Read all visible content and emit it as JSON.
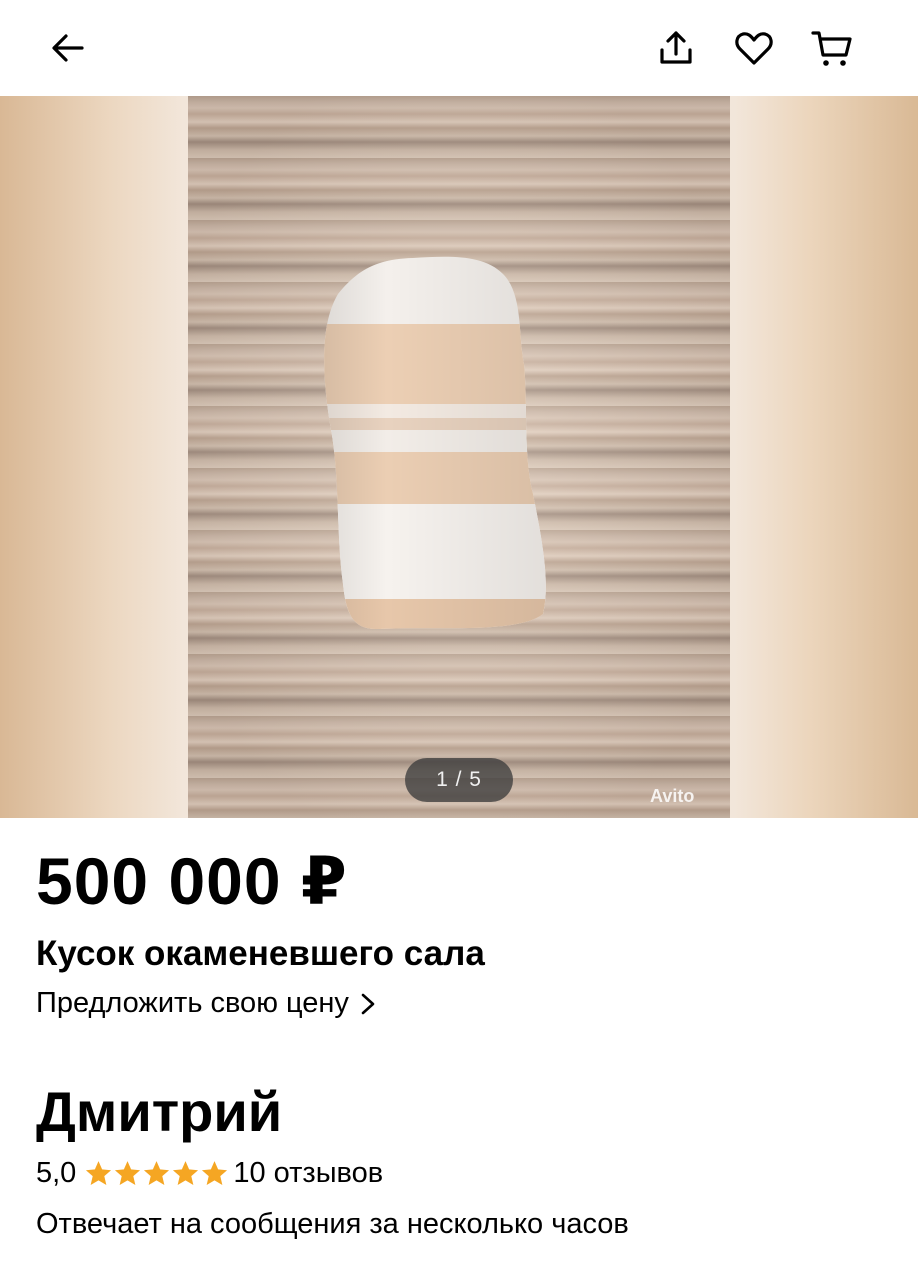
{
  "icons": {
    "back": "arrow-left-icon",
    "share": "share-icon",
    "favorite": "heart-icon",
    "cart": "cart-icon",
    "offer_chevron": "chevron-right-icon",
    "star": "star-icon"
  },
  "colors": {
    "star": "#f5a623",
    "counter_bg": "#3c3c3c"
  },
  "gallery": {
    "counter": "1 / 5",
    "watermark": "Avito"
  },
  "listing": {
    "price": "500 000 ₽",
    "title": "Кусок окаменевшего сала",
    "offer_label": "Предложить свою цену"
  },
  "seller": {
    "name": "Дмитрий",
    "rating": "5,0",
    "stars": 5,
    "reviews": "10 отзывов",
    "response_time": "Отвечает на сообщения за несколько часов"
  }
}
